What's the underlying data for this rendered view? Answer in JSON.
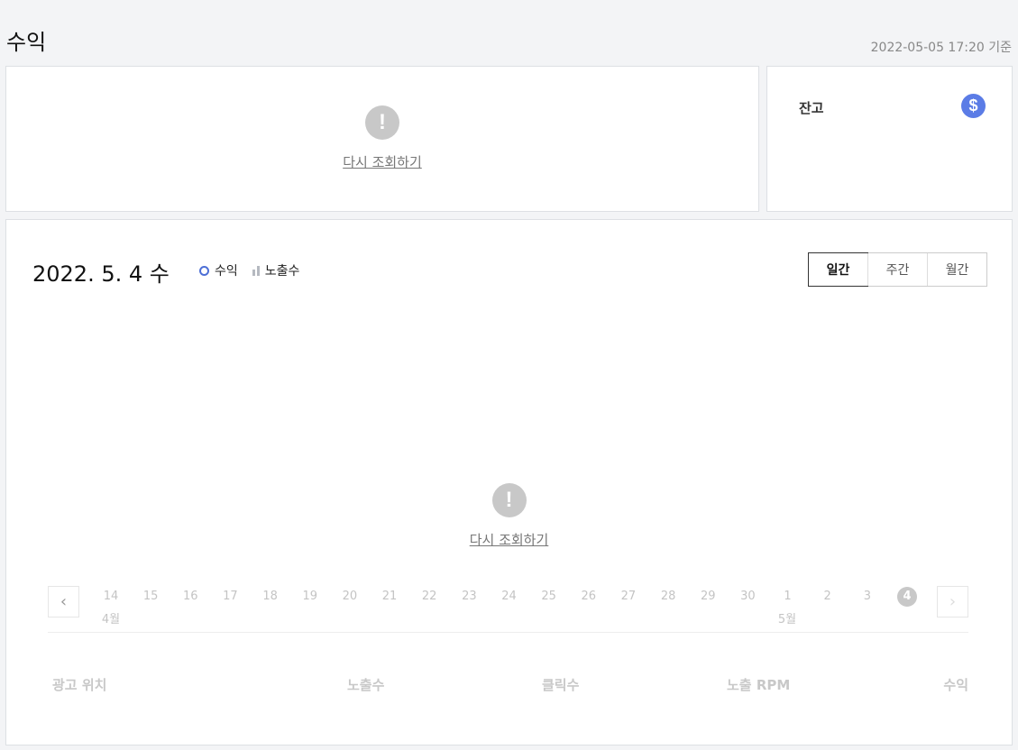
{
  "page": {
    "title": "수익",
    "timestamp": "2022-05-05 17:20 기준"
  },
  "revenue_card": {
    "error_icon": "exclamation-icon",
    "retry_label": "다시 조회하기"
  },
  "balance_card": {
    "label": "잔고",
    "icon": "dollar-icon",
    "icon_color": "#5b7ce6"
  },
  "chart_card": {
    "date_title": "2022. 5. 4 수",
    "legend": [
      {
        "label": "수익",
        "icon": "ring-marker-icon",
        "color": "#4d6fd6"
      },
      {
        "label": "노출수",
        "icon": "bar-marker-icon",
        "color": "#b5b9c0"
      }
    ],
    "period_tabs": [
      {
        "label": "일간",
        "active": true
      },
      {
        "label": "주간",
        "active": false
      },
      {
        "label": "월간",
        "active": false
      }
    ],
    "error_icon": "exclamation-icon",
    "retry_label": "다시 조회하기",
    "date_nav": {
      "prev_icon": "chevron-left-icon",
      "next_icon": "chevron-right-icon",
      "days": [
        "14",
        "15",
        "16",
        "17",
        "18",
        "19",
        "20",
        "21",
        "22",
        "23",
        "24",
        "25",
        "26",
        "27",
        "28",
        "29",
        "30",
        "1",
        "2",
        "3",
        "4"
      ],
      "selected_day": "4",
      "month_labels": {
        "april": "4월",
        "may": "5월"
      }
    },
    "table_headers": [
      "광고 위치",
      "노출수",
      "클릭수",
      "노출 RPM",
      "수익"
    ]
  }
}
